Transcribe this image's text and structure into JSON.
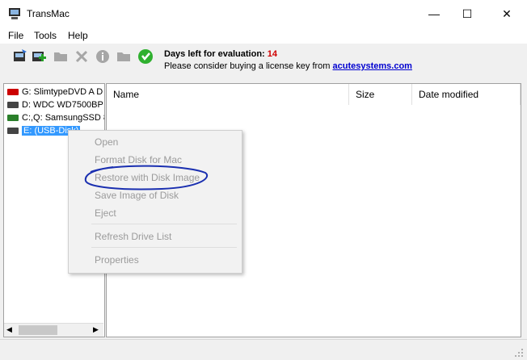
{
  "window": {
    "title": "TransMac",
    "minimize": "—",
    "maximize": "☐",
    "close": "✕"
  },
  "menu": [
    "File",
    "Tools",
    "Help"
  ],
  "toolbar": {
    "icons": [
      "open-disk-icon",
      "add-disk-icon",
      "folder-icon",
      "delete-icon",
      "info-icon",
      "folder2-icon",
      "help-icon"
    ],
    "eval_label": "Days left for evaluation:",
    "eval_days": "14",
    "eval_msg": "Please consider buying a license key from",
    "eval_link": "acutesystems.com"
  },
  "drives": [
    {
      "label": "G: SlimtypeDVD A  D",
      "selected": false
    },
    {
      "label": "D: WDC WD7500BP",
      "selected": false
    },
    {
      "label": "C:,Q: SamsungSSD 8",
      "selected": false
    },
    {
      "label": "E:  (USB-Disk)",
      "selected": true
    }
  ],
  "columns": [
    "Name",
    "Size",
    "Date modified"
  ],
  "context_menu": {
    "items": [
      "Open",
      "Format Disk for Mac",
      "Restore with Disk Image",
      "Save Image of Disk",
      "Eject",
      "Refresh Drive List",
      "Properties"
    ],
    "enabled": false,
    "annotation_color": "#1a2fb0"
  },
  "scroll": {
    "left_arrow": "◀",
    "right_arrow": "▶"
  },
  "colors": {
    "selection": "#3399ff",
    "eval_number": "#d00000",
    "link": "#0000d0"
  }
}
